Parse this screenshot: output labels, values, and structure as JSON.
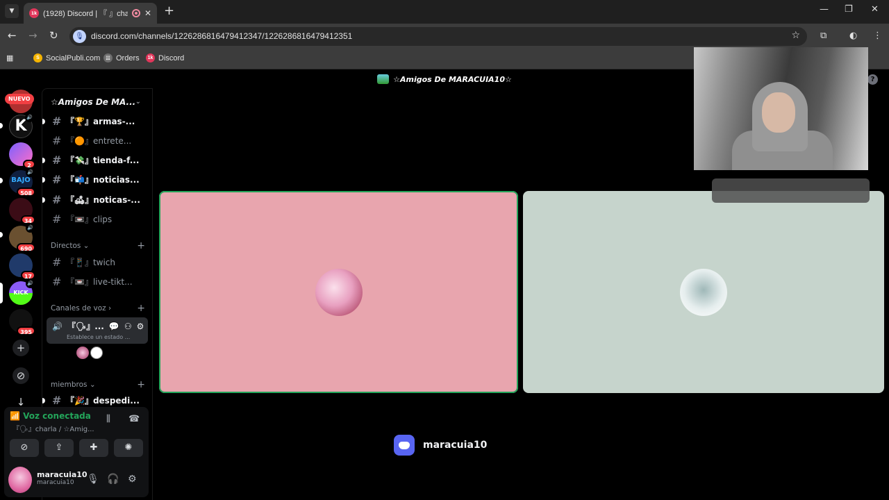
{
  "browser": {
    "tab": {
      "title": "(1928) Discord | 『 』charla"
    },
    "url": "discord.com/channels/1226286816479412347/1226286816479412351",
    "bookmarks": [
      {
        "label": "SocialPubli.com",
        "color": "#f5b400"
      },
      {
        "label": "Orders",
        "color": "#6e6e6e"
      },
      {
        "label": "Discord",
        "color": "#e0365a"
      }
    ]
  },
  "discord": {
    "window_title": "☆Amigos De MARACUIA10☆",
    "guilds": {
      "new_label": "NUEVO",
      "badges": [
        "2",
        "508",
        "34",
        "690",
        "17",
        "395"
      ]
    },
    "server": {
      "name": "☆Amigos De MA...",
      "channels": [
        {
          "label": "『🏆』armas-...",
          "unread": true
        },
        {
          "label": "『🟠』entrete...",
          "unread": false
        },
        {
          "label": "『💸』tienda-f...",
          "unread": true
        },
        {
          "label": "『📬』noticias...",
          "unread": true
        },
        {
          "label": "『🛋』noticas-...",
          "unread": true
        },
        {
          "label": "『📼』clips",
          "unread": false
        }
      ],
      "category_directos": "Directos",
      "directos_channels": [
        {
          "label": "『📱』twich"
        },
        {
          "label": "『📼』live-tikt..."
        }
      ],
      "category_voice": "Canales de voz",
      "voice_channel": {
        "label": "『🗣』...",
        "status": "Establece un estado ..."
      },
      "category_miembros": "miembros",
      "miembros_channels": [
        {
          "label": "『🎉』despedi...",
          "unread": true
        }
      ]
    },
    "panel": {
      "voice_status": "Voz conectada",
      "voice_location": "『🗣』charla / ☆Amig...",
      "username": "maracuia10",
      "user_tag": "maracuia10"
    },
    "stage": {
      "streamer": "maracuia10",
      "tile_colors": [
        "#e8a5ae",
        "#c6d4cc"
      ]
    },
    "accent": "#5865f2",
    "speaking_color": "#23a55a"
  }
}
